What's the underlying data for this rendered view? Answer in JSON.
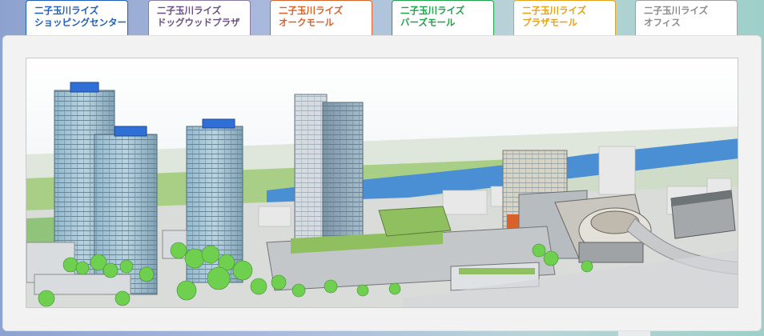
{
  "tabs": [
    {
      "line1": "二子玉川ライズ",
      "line2": "ショッピングセンター",
      "color": "#1d5fbf",
      "border": "#1d5fbf"
    },
    {
      "line1": "二子玉川ライズ",
      "line2": "ドッグウッドプラザ",
      "color": "#6a4f86",
      "border": "#8a7aa6"
    },
    {
      "line1": "二子玉川ライズ",
      "line2": "オークモール",
      "color": "#d9622a",
      "border": "#d9622a"
    },
    {
      "line1": "二子玉川ライズ",
      "line2": "バーズモール",
      "color": "#1fa34a",
      "border": "#1fa34a"
    },
    {
      "line1": "二子玉川ライズ",
      "line2": "プラザモール",
      "color": "#e8a11a",
      "border": "#e8a11a"
    },
    {
      "line1": "二子玉川ライズ",
      "line2": "オフィス",
      "color": "#8c8c8c",
      "border": "#a0a0a0"
    }
  ],
  "colors": {
    "sky": "#e9eff1",
    "river": "#4a8fd3",
    "grass": "#7fbf6a",
    "tower_glass": "#5fa9c9",
    "roof_blue": "#2f6fd6"
  }
}
